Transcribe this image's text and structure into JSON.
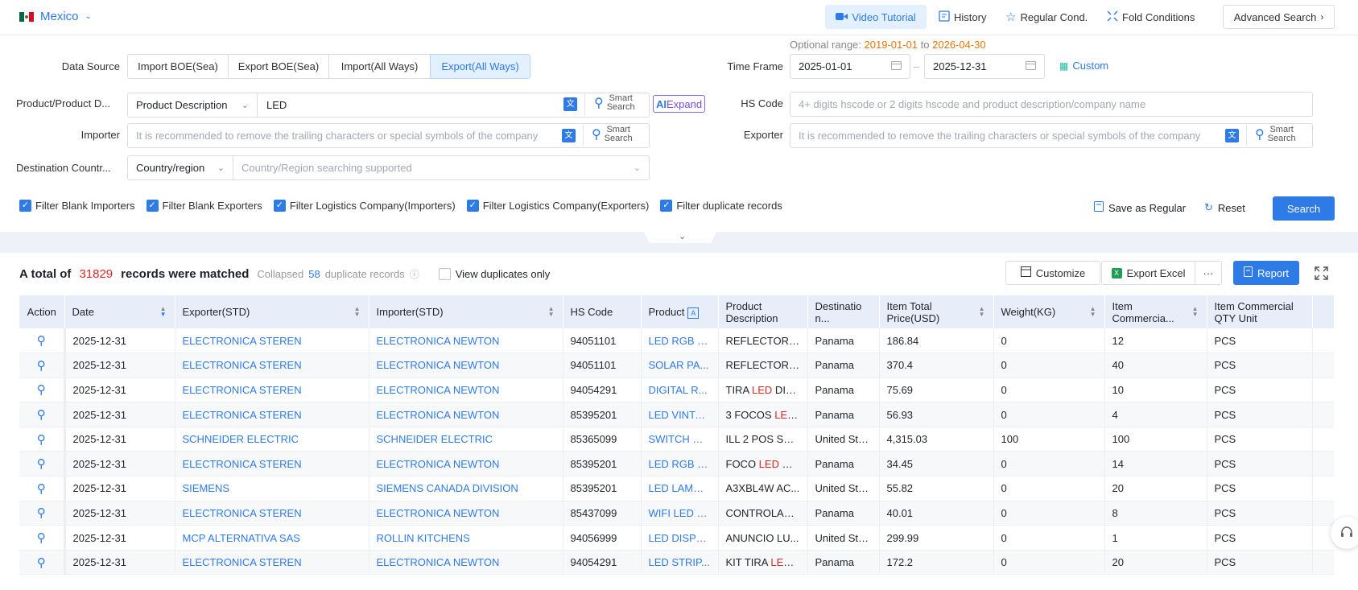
{
  "country": {
    "name": "Mexico"
  },
  "topbar": {
    "video_tutorial": "Video Tutorial",
    "history": "History",
    "regular_cond": "Regular Cond.",
    "fold_conditions": "Fold Conditions",
    "advanced_search": "Advanced Search"
  },
  "optional_range": {
    "label": "Optional range:",
    "start": "2019-01-01",
    "to": "to",
    "end": "2026-04-30"
  },
  "form": {
    "data_source_label": "Data Source",
    "data_source_options": [
      "Import BOE(Sea)",
      "Export BOE(Sea)",
      "Import(All Ways)",
      "Export(All Ways)"
    ],
    "time_frame_label": "Time Frame",
    "time_start": "2025-01-01",
    "time_end": "2025-12-31",
    "custom": "Custom",
    "product_label": "Product/Product D...",
    "product_type": "Product Description",
    "product_value": "LED",
    "smart_search_1": "Smart",
    "smart_search_2": "Search",
    "ai_prefix": "AI",
    "ai_expand": "Expand",
    "hs_code_label": "HS Code",
    "hs_code_placeholder": "4+ digits hscode or 2 digits hscode and product description/company name",
    "importer_label": "Importer",
    "importer_placeholder": "It is recommended to remove the trailing characters or special symbols of the company",
    "exporter_label": "Exporter",
    "exporter_placeholder": "It is recommended to remove the trailing characters or special symbols of the company",
    "destination_label": "Destination Countr...",
    "destination_type": "Country/region",
    "destination_placeholder": "Country/Region searching supported"
  },
  "filters": [
    {
      "label": "Filter Blank Importers",
      "checked": true
    },
    {
      "label": "Filter Blank Exporters",
      "checked": true
    },
    {
      "label": "Filter Logistics Company(Importers)",
      "checked": true
    },
    {
      "label": "Filter Logistics Company(Exporters)",
      "checked": true
    },
    {
      "label": "Filter duplicate records",
      "checked": true
    }
  ],
  "actions": {
    "save_as_regular": "Save as Regular",
    "reset": "Reset",
    "search": "Search"
  },
  "summary": {
    "prefix": "A total of",
    "count": "31829",
    "suffix": "records were matched",
    "collapsed": "Collapsed",
    "dup_count": "58",
    "dup_label": "duplicate records",
    "view_dup": "View duplicates only"
  },
  "toolbar": {
    "customize": "Customize",
    "export_excel": "Export Excel",
    "more": "···",
    "report": "Report"
  },
  "table": {
    "headers": [
      "Action",
      "Date",
      "Exporter(STD)",
      "Importer(STD)",
      "HS Code",
      "Product",
      "Product Description",
      "Destinatio n...",
      "Item Total Price(USD)",
      "Weight(KG)",
      "Item Commercia...",
      "Item Commercial QTY Unit"
    ],
    "rows": [
      {
        "date": "2025-12-31",
        "exporter": "ELECTRONICA STEREN",
        "importer": "ELECTRONICA NEWTON",
        "hs": "94051101",
        "product": "LED RGB O...",
        "desc_pre": "REFLECTOR ",
        "desc_hl": "L...",
        "desc_post": "",
        "dest": "Panama",
        "price": "186.84",
        "weight": "0",
        "qty": "12",
        "unit": "PCS"
      },
      {
        "date": "2025-12-31",
        "exporter": "ELECTRONICA STEREN",
        "importer": "ELECTRONICA NEWTON",
        "hs": "94051101",
        "product": "SOLAR PA...",
        "desc_pre": "REFLECTOR ",
        "desc_hl": "L...",
        "desc_post": "",
        "dest": "Panama",
        "price": "370.4",
        "weight": "0",
        "qty": "40",
        "unit": "PCS"
      },
      {
        "date": "2025-12-31",
        "exporter": "ELECTRONICA STEREN",
        "importer": "ELECTRONICA NEWTON",
        "hs": "94054291",
        "product": "DIGITAL R...",
        "desc_pre": "TIRA ",
        "desc_hl": "LED",
        "desc_post": " DIGI...",
        "dest": "Panama",
        "price": "75.69",
        "weight": "0",
        "qty": "10",
        "unit": "PCS"
      },
      {
        "date": "2025-12-31",
        "exporter": "ELECTRONICA STEREN",
        "importer": "ELECTRONICA NEWTON",
        "hs": "85395201",
        "product": "LED VINTA...",
        "desc_pre": "3 FOCOS ",
        "desc_hl": "LED",
        "desc_post": " ...",
        "dest": "Panama",
        "price": "56.93",
        "weight": "0",
        "qty": "4",
        "unit": "PCS"
      },
      {
        "date": "2025-12-31",
        "exporter": "SCHNEIDER ELECTRIC",
        "importer": "SCHNEIDER ELECTRIC",
        "hs": "85365099",
        "product": "SWITCH W...",
        "desc_pre": "ILL 2 POS SEL...",
        "desc_hl": "",
        "desc_post": "",
        "dest": "United Sta...",
        "price": "4,315.03",
        "weight": "100",
        "qty": "100",
        "unit": "PCS"
      },
      {
        "date": "2025-12-31",
        "exporter": "ELECTRONICA STEREN",
        "importer": "ELECTRONICA NEWTON",
        "hs": "85395201",
        "product": "LED RGB D...",
        "desc_pre": "FOCO ",
        "desc_hl": "LED",
        "desc_post": " RG...",
        "dest": "Panama",
        "price": "34.45",
        "weight": "0",
        "qty": "14",
        "unit": "PCS"
      },
      {
        "date": "2025-12-31",
        "exporter": "SIEMENS",
        "importer": "SIEMENS CANADA DIVISION",
        "hs": "85395201",
        "product": "LED LAMP ...",
        "desc_pre": "A3XBL4W AC...",
        "desc_hl": "",
        "desc_post": "",
        "dest": "United Sta...",
        "price": "55.82",
        "weight": "0",
        "qty": "20",
        "unit": "PCS"
      },
      {
        "date": "2025-12-31",
        "exporter": "ELECTRONICA STEREN",
        "importer": "ELECTRONICA NEWTON",
        "hs": "85437099",
        "product": "WIFI LED S...",
        "desc_pre": "CONTROLAD...",
        "desc_hl": "",
        "desc_post": "",
        "dest": "Panama",
        "price": "40.01",
        "weight": "0",
        "qty": "8",
        "unit": "PCS"
      },
      {
        "date": "2025-12-31",
        "exporter": "MCP ALTERNATIVA SAS",
        "importer": "ROLLIN KITCHENS",
        "hs": "94056999",
        "product": "LED DISPL...",
        "desc_pre": "ANUNCIO LU...",
        "desc_hl": "",
        "desc_post": "",
        "dest": "United Sta...",
        "price": "299.99",
        "weight": "0",
        "qty": "1",
        "unit": "PCS"
      },
      {
        "date": "2025-12-31",
        "exporter": "ELECTRONICA STEREN",
        "importer": "ELECTRONICA NEWTON",
        "hs": "94054291",
        "product": "LED STRIP...",
        "desc_pre": "KIT TIRA ",
        "desc_hl": "LED",
        "desc_post": " ...",
        "dest": "Panama",
        "price": "172.2",
        "weight": "0",
        "qty": "20",
        "unit": "PCS"
      }
    ]
  },
  "colors": {
    "accent": "#2e7ae6",
    "highlight": "#e02424",
    "range": "#e8760c"
  }
}
